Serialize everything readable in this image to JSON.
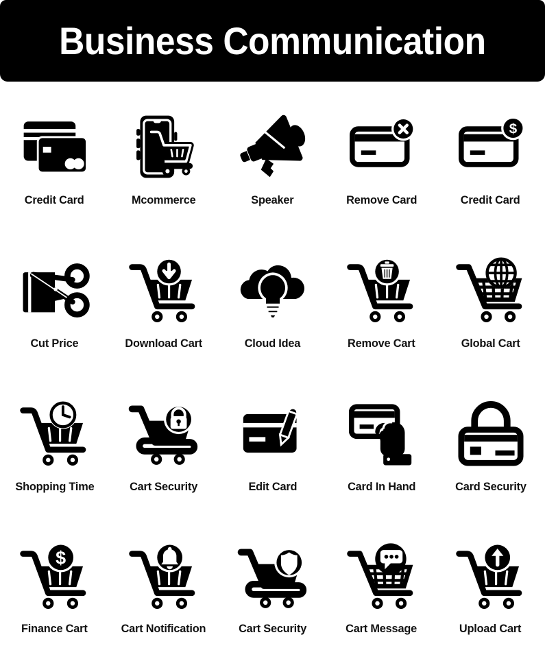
{
  "header": {
    "title": "Business Communication",
    "background_color": "#000000",
    "text_color": "#ffffff"
  },
  "theme": {
    "icon_color": "#000000",
    "page_background": "#ffffff",
    "label_color": "#111111"
  },
  "grid": {
    "columns": 5,
    "rows": 4,
    "total_icons": 20
  },
  "icons": [
    {
      "label": "Credit Card",
      "icon": "credit-cards-stack-icon"
    },
    {
      "label": "Mcommerce",
      "icon": "mobile-phone-cart-icon"
    },
    {
      "label": "Speaker",
      "icon": "megaphone-icon"
    },
    {
      "label": "Remove Card",
      "icon": "card-remove-cross-icon"
    },
    {
      "label": "Credit Card",
      "icon": "card-dollar-badge-icon"
    },
    {
      "label": "Cut Price",
      "icon": "card-scissors-icon"
    },
    {
      "label": "Download Cart",
      "icon": "cart-download-arrow-icon"
    },
    {
      "label": "Cloud Idea",
      "icon": "cloud-lightbulb-icon"
    },
    {
      "label": "Remove Cart",
      "icon": "cart-trash-icon"
    },
    {
      "label": "Global Cart",
      "icon": "cart-globe-icon"
    },
    {
      "label": "Shopping Time",
      "icon": "cart-clock-icon"
    },
    {
      "label": "Cart Security",
      "icon": "cart-padlock-icon"
    },
    {
      "label": "Edit Card",
      "icon": "card-pen-icon"
    },
    {
      "label": "Card In Hand",
      "icon": "hand-holding-card-icon"
    },
    {
      "label": "Card Security",
      "icon": "card-padlock-icon"
    },
    {
      "label": "Finance Cart",
      "icon": "cart-dollar-coin-icon"
    },
    {
      "label": "Cart Notification",
      "icon": "cart-bell-icon"
    },
    {
      "label": "Cart Security",
      "icon": "cart-shield-icon"
    },
    {
      "label": "Cart Message",
      "icon": "cart-speech-bubble-icon"
    },
    {
      "label": "Upload Cart",
      "icon": "cart-upload-arrow-icon"
    }
  ]
}
